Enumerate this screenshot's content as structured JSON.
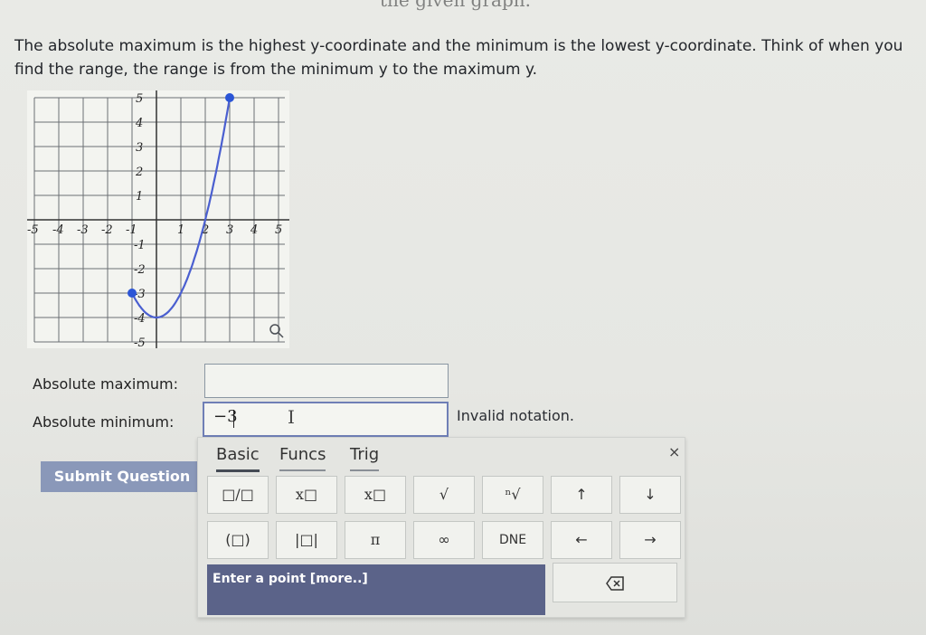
{
  "top_fragment": "the given graph.",
  "instructions": "The absolute maximum is the highest y-coordinate and the minimum is the lowest y-coordinate. Think of when you find the range, the range is from the minimum y to the maximum y.",
  "graph": {
    "x_ticks": [
      "-5",
      "-4",
      "-3",
      "-2",
      "-1",
      "1",
      "2",
      "3",
      "4",
      "5"
    ],
    "y_ticks": [
      "5",
      "4",
      "3",
      "2",
      "1",
      "-1",
      "-2",
      "-3",
      "-4",
      "-5"
    ],
    "endpoint_left": {
      "x": -1,
      "y": -3
    },
    "endpoint_right": {
      "x": 3,
      "y": 5
    },
    "vertex": {
      "x": 0,
      "y": -4
    },
    "curve_color": "#4a5fd0",
    "zoom_icon": "magnifier-icon"
  },
  "form": {
    "max_label": "Absolute maximum:",
    "max_value": "",
    "min_label": "Absolute minimum:",
    "min_value": "−3",
    "error_text": "Invalid notation."
  },
  "submit_label": "Submit Question",
  "keyboard": {
    "tabs": [
      "Basic",
      "Funcs",
      "Trig"
    ],
    "close": "×",
    "row1": [
      "□/□",
      "x□",
      "x□",
      "√",
      "ⁿ√",
      "↑",
      "↓"
    ],
    "row2": [
      "(□)",
      "|□|",
      "π",
      "∞",
      "DNE",
      "←",
      "→"
    ],
    "point_bar": "Enter a point [more..]",
    "backspace_icon": "backspace-icon"
  },
  "colors": {
    "accent": "#5b6389",
    "submit": "#8a98b9",
    "point_blue": "#2b55d6"
  }
}
